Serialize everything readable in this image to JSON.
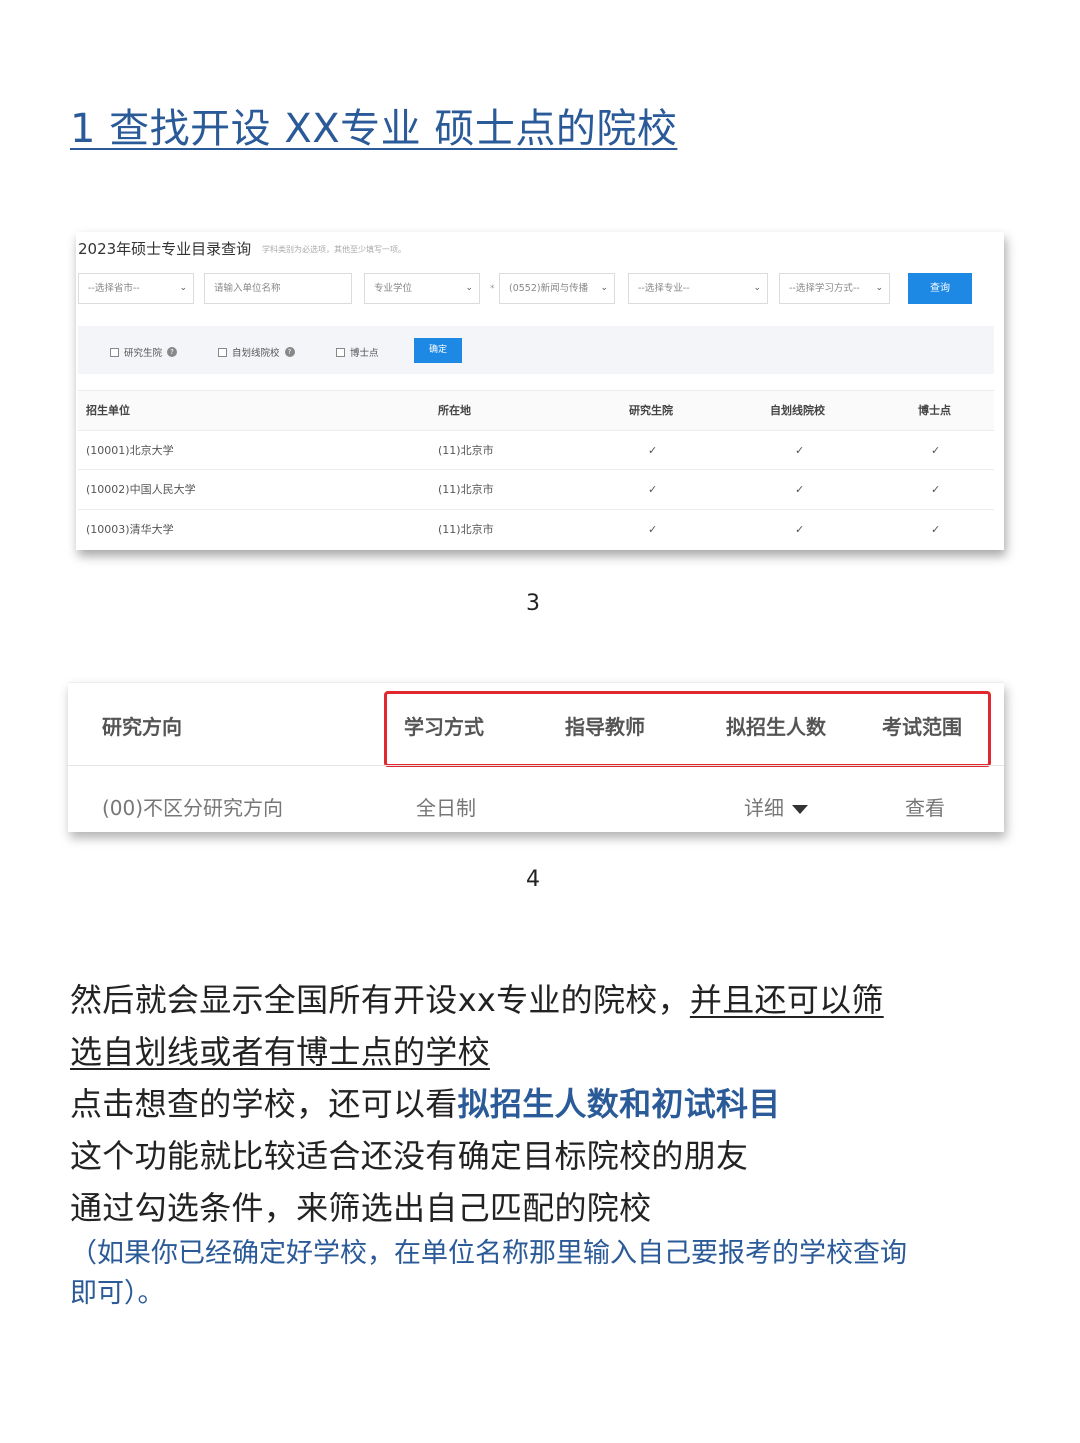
{
  "heading": "1 查找开设 XX专业 硕士点的院校",
  "query_panel": {
    "title": "2023年硕士专业目录查询",
    "hint": "学科类别为必选项，其他至少填写一项。",
    "province_select": "--选择省市--",
    "unit_name_placeholder": "请输入单位名称",
    "degree_select": "专业学位",
    "required_mark": "*",
    "discipline_select": "(0552)新闻与传播",
    "major_select": "--选择专业--",
    "study_mode_select": "--选择学习方式--",
    "query_button": "查询",
    "filters": {
      "graduate_school": "研究生院",
      "self_line": "自划线院校",
      "phd_point": "博士点",
      "confirm_button": "确定"
    },
    "table": {
      "headers": [
        "招生单位",
        "所在地",
        "研究生院",
        "自划线院校",
        "博士点"
      ],
      "rows": [
        {
          "unit": "(10001)北京大学",
          "location": "(11)北京市",
          "graduate_school": "✓",
          "self_line": "✓",
          "phd_point": "✓"
        },
        {
          "unit": "(10002)中国人民大学",
          "location": "(11)北京市",
          "graduate_school": "✓",
          "self_line": "✓",
          "phd_point": "✓"
        },
        {
          "unit": "(10003)清华大学",
          "location": "(11)北京市",
          "graduate_school": "✓",
          "self_line": "✓",
          "phd_point": "✓"
        }
      ]
    }
  },
  "caption_1": "3",
  "direction_panel": {
    "headers": {
      "direction": "研究方向",
      "study_mode": "学习方式",
      "advisor": "指导教师",
      "enrollment": "拟招生人数",
      "exam_scope": "考试范围"
    },
    "row": {
      "direction": "(00)不区分研究方向",
      "study_mode": "全日制",
      "enrollment_link": "详细",
      "exam_link": "查看"
    }
  },
  "caption_2": "4",
  "paragraphs": {
    "p1_plain": "然后就会显示全国所有开设xx专业的院校，",
    "p1_underlined_a": "并且还可以筛",
    "p1_underlined_b": "选自划线或者有博士点的学校",
    "p2_plain": "点击想查的学校，还可以看",
    "p2_highlight": "拟招生人数和初试科目",
    "p3": "这个功能就比较适合还没有确定目标院校的朋友",
    "p4": "通过勾选条件，来筛选出自己匹配的院校",
    "note_a": "（如果你已经确定好学校，在单位名称那里输入自己要报考的学校查询",
    "note_b": "即可）。"
  },
  "colors": {
    "accent_blue": "#2b5a98",
    "button_blue": "#1e88e5",
    "highlight_red": "#e0282e"
  }
}
